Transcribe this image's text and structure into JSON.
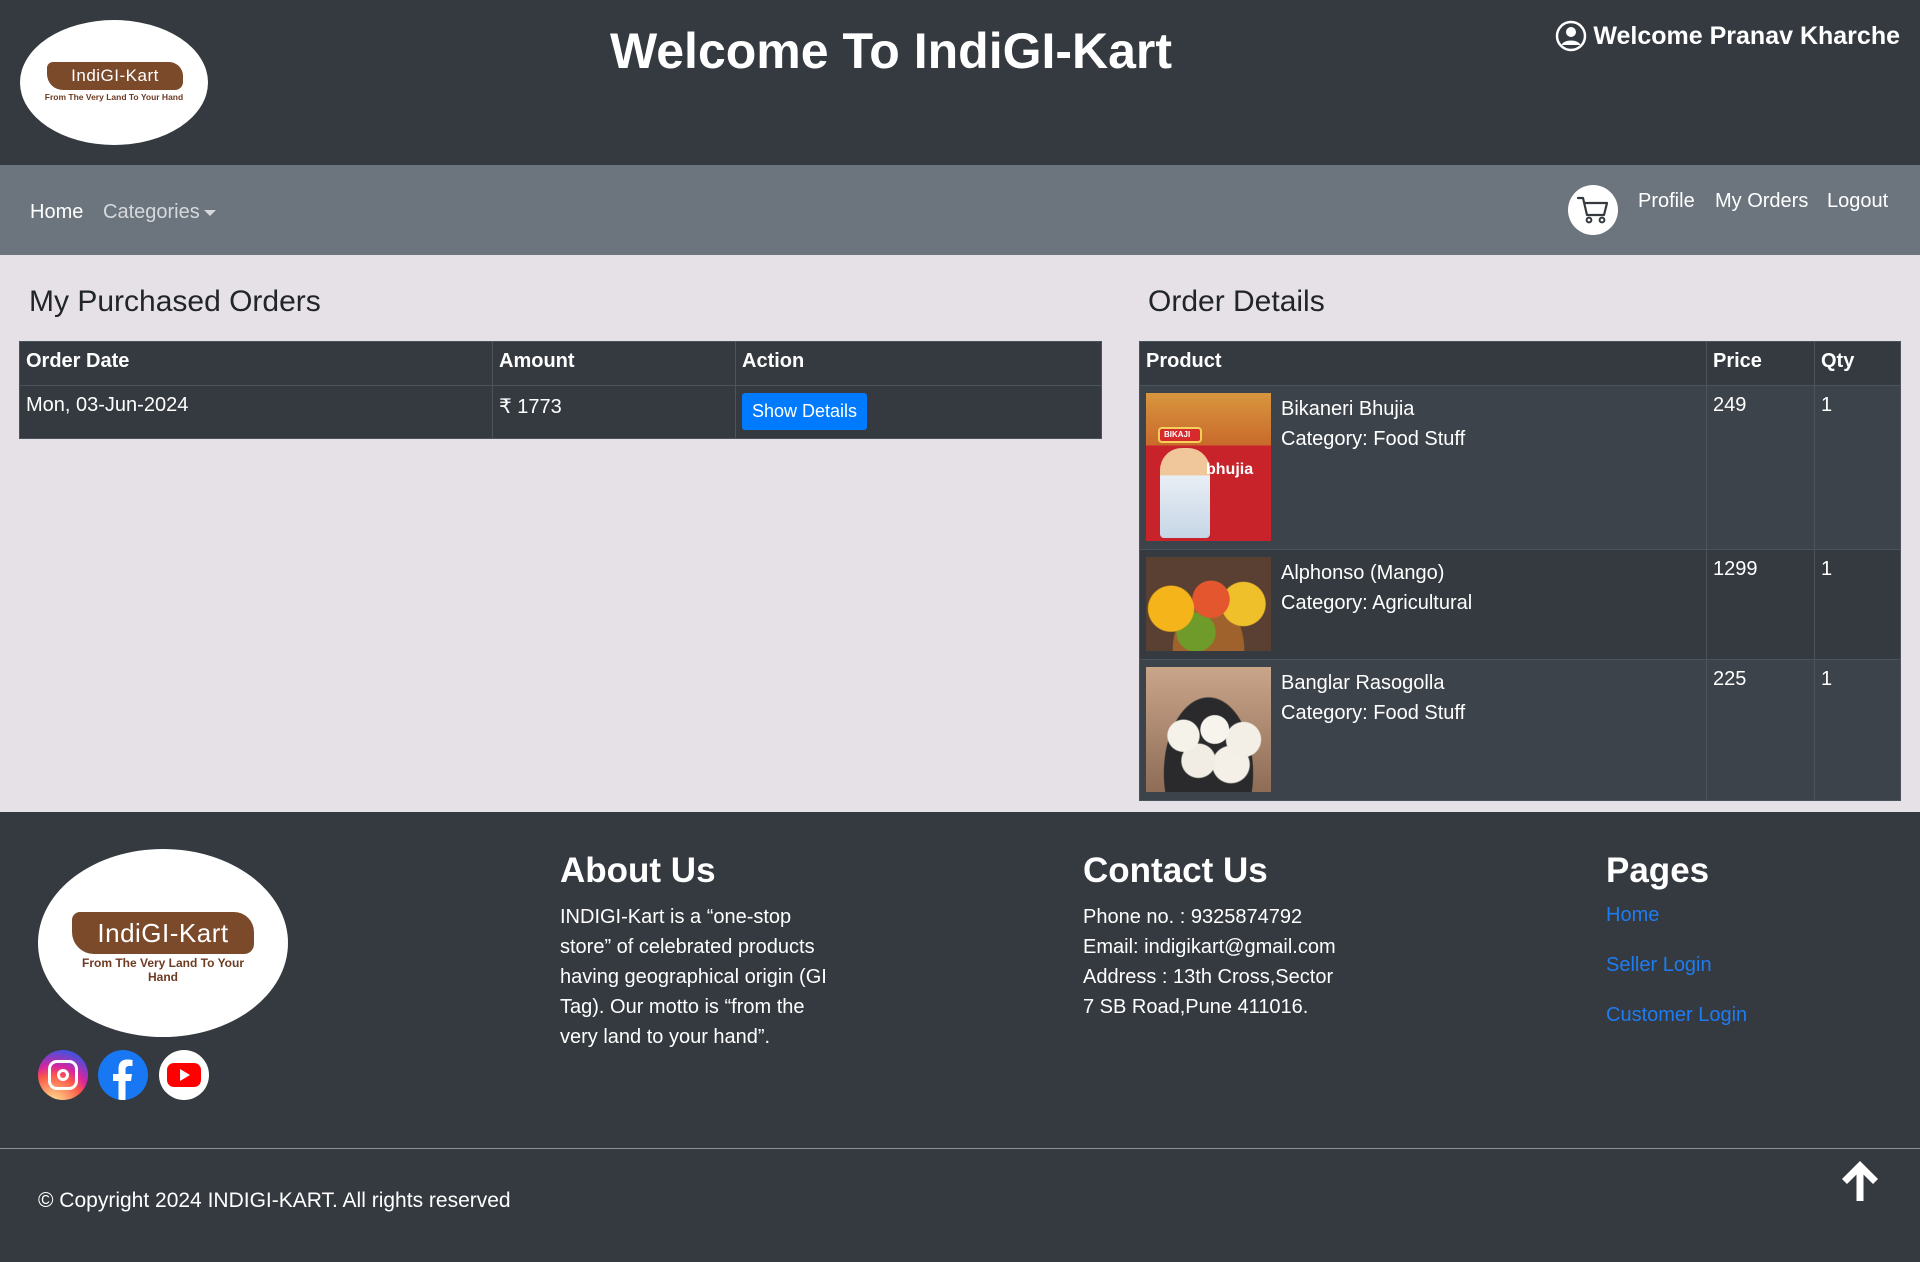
{
  "header": {
    "logo_text": "IndiGI-Kart",
    "logo_tagline": "From The Very Land To Your Hand",
    "title": "Welcome To IndiGI-Kart",
    "welcome_user": "Welcome Pranav Kharche",
    "user_icon": "user-circle-icon"
  },
  "nav": {
    "home": "Home",
    "categories": "Categories",
    "cart_icon": "cart-icon",
    "profile": "Profile",
    "my_orders": "My Orders",
    "logout": "Logout"
  },
  "orders": {
    "heading": "My Purchased Orders",
    "columns": [
      "Order Date",
      "Amount",
      "Action"
    ],
    "rows": [
      {
        "date": "Mon, 03-Jun-2024",
        "amount": "₹ 1773",
        "action": "Show Details"
      }
    ]
  },
  "details": {
    "heading": "Order Details",
    "columns": [
      "Product",
      "Price",
      "Qty"
    ],
    "items": [
      {
        "name": "Bikaneri Bhujia",
        "category": "Category: Food Stuff",
        "price": "249",
        "qty": "1",
        "image_word": "bhujia",
        "image_label": "BIKAJI"
      },
      {
        "name": "Alphonso (Mango)",
        "category": "Category: Agricultural",
        "price": "1299",
        "qty": "1"
      },
      {
        "name": "Banglar Rasogolla",
        "category": "Category: Food Stuff",
        "price": "225",
        "qty": "1"
      }
    ]
  },
  "footer": {
    "logo_text": "IndiGI-Kart",
    "logo_tagline": "From The Very Land To Your Hand",
    "social": [
      "instagram-icon",
      "facebook-icon",
      "youtube-icon"
    ],
    "about_heading": "About Us",
    "about_lines": [
      "INDIGI-Kart is a “one-stop",
      "store” of celebrated products",
      "having geographical origin (GI",
      "Tag). Our motto is “from the",
      "very land to your hand”."
    ],
    "contact_heading": "Contact Us",
    "contact_lines": [
      "Phone no. : 9325874792",
      "Email: indigikart@gmail.com",
      "Address : 13th Cross,Sector",
      "7 SB Road,Pune 411016."
    ],
    "pages_heading": "Pages",
    "pages_links": [
      "Home",
      "Seller Login",
      "Customer Login"
    ],
    "copyright": "© Copyright 2024 INDIGI-KART. All rights reserved",
    "back_to_top_icon": "arrow-up-icon"
  },
  "colors": {
    "header_bg": "#343a40",
    "navbar_bg": "#6c757d",
    "page_bg": "#e6e1e7",
    "button_primary": "#007bff",
    "link": "#1e7cf2",
    "logo_brown": "#7b4a2b"
  }
}
